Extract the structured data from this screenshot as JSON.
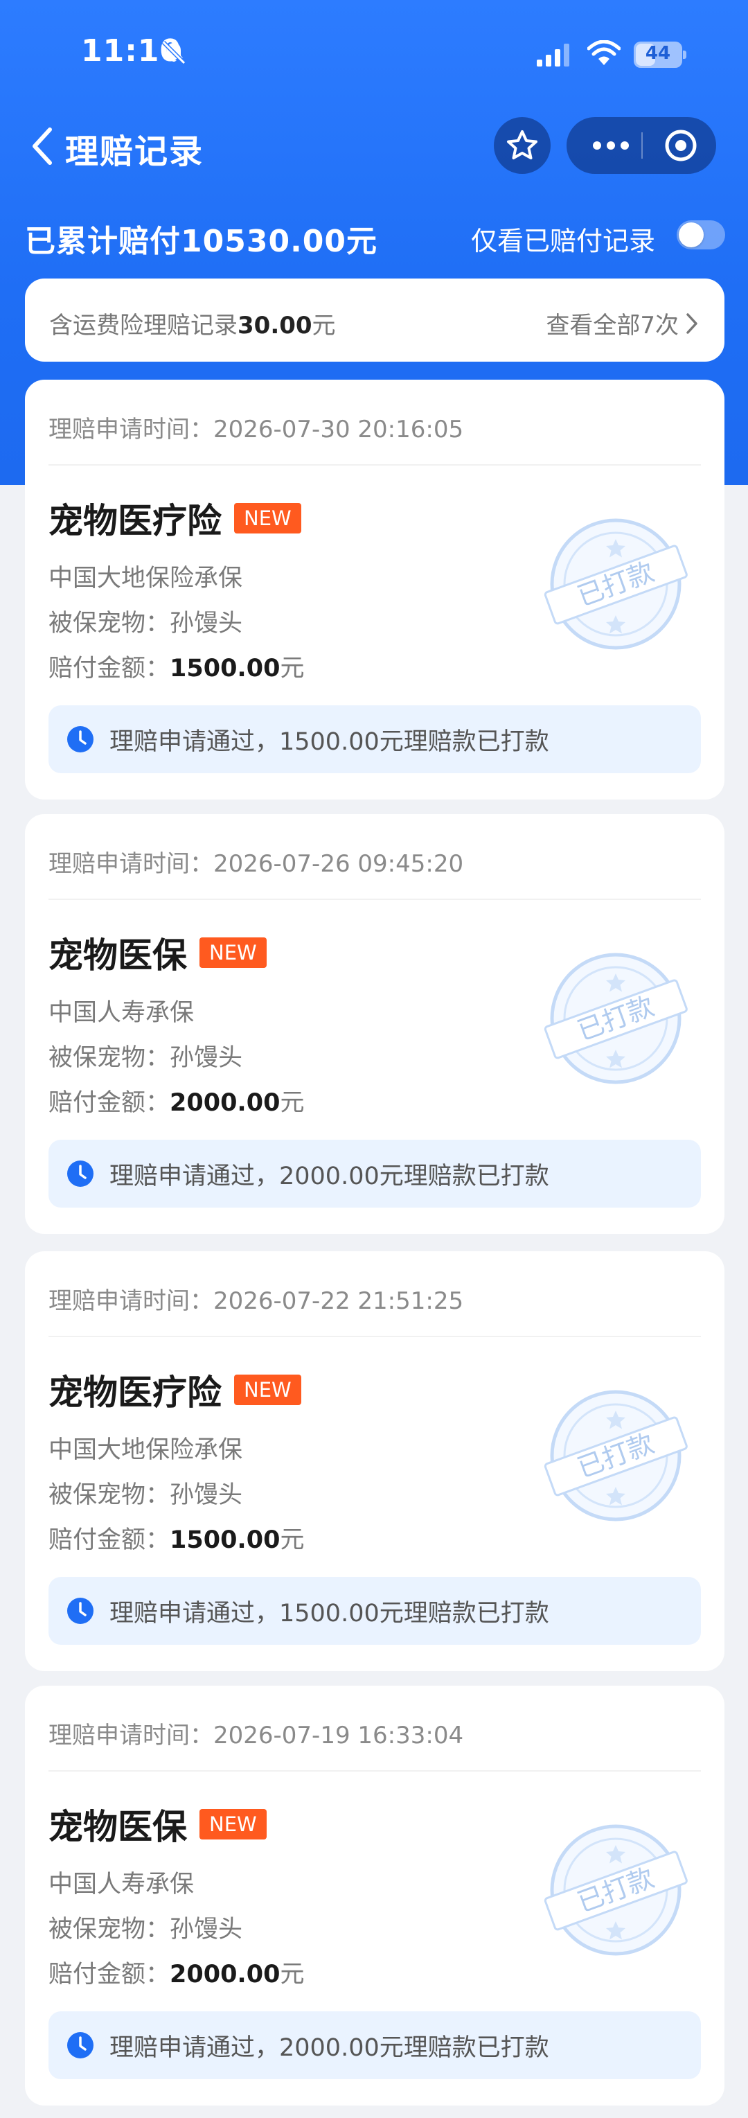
{
  "status_bar": {
    "time": "11:10",
    "battery": "44",
    "battery_level": 0.44,
    "icons": [
      "bell-slash-icon",
      "signal-icon",
      "wifi-icon",
      "battery-icon"
    ]
  },
  "nav": {
    "title": "理赔记录",
    "icons": [
      "chevron-left-icon",
      "star-icon",
      "more-dots-icon",
      "target-icon"
    ]
  },
  "summary_row": {
    "total_prefix": "已累计赔付",
    "total_amount": "10530.00",
    "total_suffix": "元",
    "filter_label": "仅看已赔付记录",
    "filter_on": false
  },
  "summary_card": {
    "left_prefix": "含运费险理赔记录",
    "left_amount": "30.00",
    "left_suffix": "元",
    "right_label": "查看全部7次"
  },
  "labels": {
    "time_label": "理赔申请时间：",
    "pet_label": "被保宠物：",
    "amount_label": "赔付金额：",
    "amount_unit": "元",
    "badge": "NEW",
    "stamp": "已打款"
  },
  "claims": [
    {
      "time": "2026-07-30 20:16:05",
      "product": "宠物医疗险",
      "insurer": "中国大地保险承保",
      "pet": "孙馒头",
      "amount": "1500.00",
      "notice": "理赔申请通过，1500.00元理赔款已打款"
    },
    {
      "time": "2026-07-26 09:45:20",
      "product": "宠物医保",
      "insurer": "中国人寿承保",
      "pet": "孙馒头",
      "amount": "2000.00",
      "notice": "理赔申请通过，2000.00元理赔款已打款"
    },
    {
      "time": "2026-07-22 21:51:25",
      "product": "宠物医疗险",
      "insurer": "中国大地保险承保",
      "pet": "孙馒头",
      "amount": "1500.00",
      "notice": "理赔申请通过，1500.00元理赔款已打款"
    },
    {
      "time": "2026-07-19 16:33:04",
      "product": "宠物医保",
      "insurer": "中国人寿承保",
      "pet": "孙馒头",
      "amount": "2000.00",
      "notice": "理赔申请通过，2000.00元理赔款已打款"
    }
  ],
  "colors": {
    "brand_blue": "#1f6ef5",
    "badge_orange": "#ff5a1f",
    "notice_bg": "#eaf3ff",
    "stamp_blue": "#b7d2f5"
  }
}
